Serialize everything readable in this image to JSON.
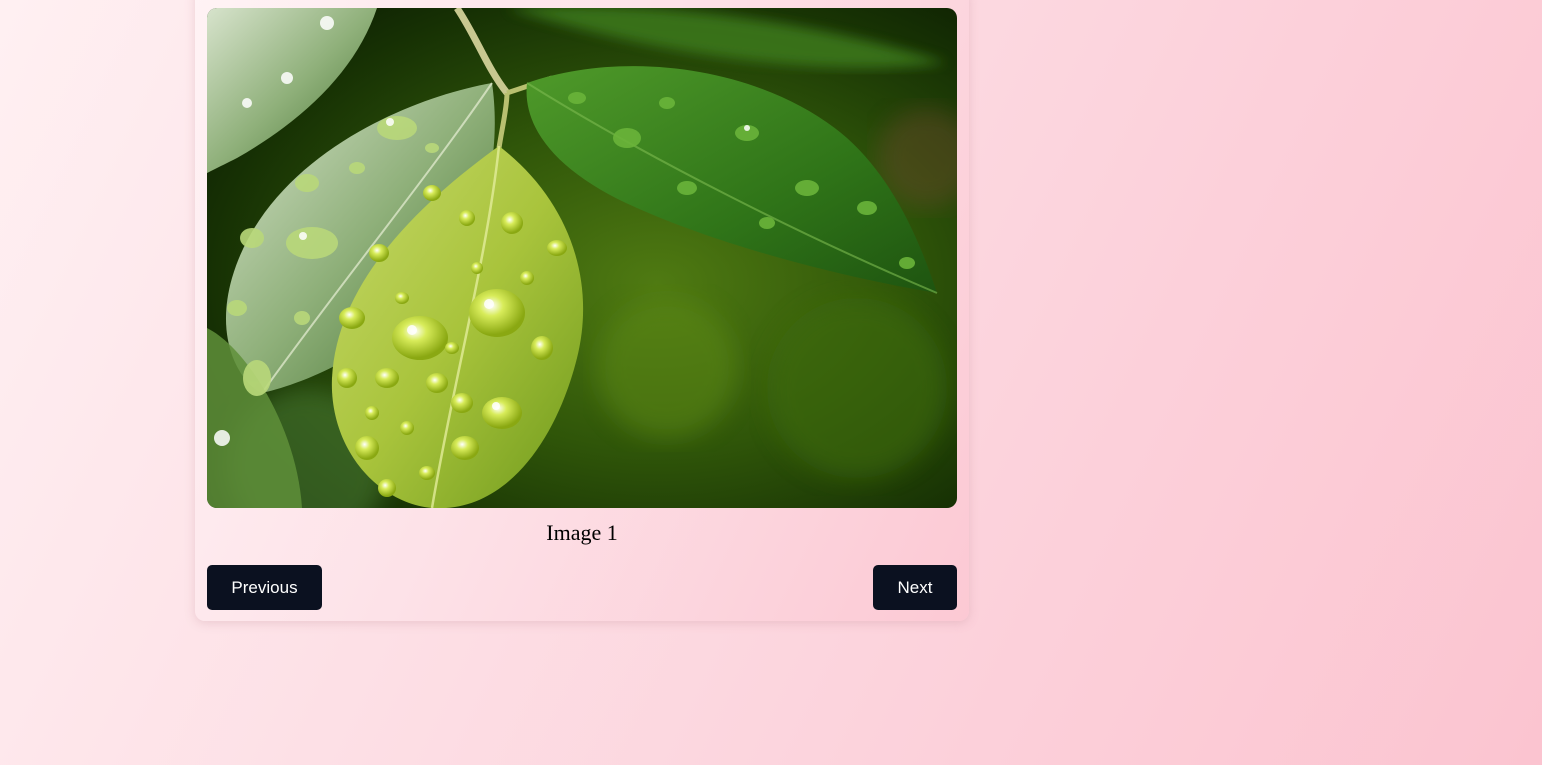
{
  "slider": {
    "caption": "Image 1",
    "image_subject": "leaves-with-water-drops",
    "previous_label": "Previous",
    "next_label": "Next"
  },
  "colors": {
    "button_bg": "#0b1120",
    "button_text": "#ffffff",
    "background_start": "#fff0f2",
    "background_end": "#fbc4d0"
  }
}
